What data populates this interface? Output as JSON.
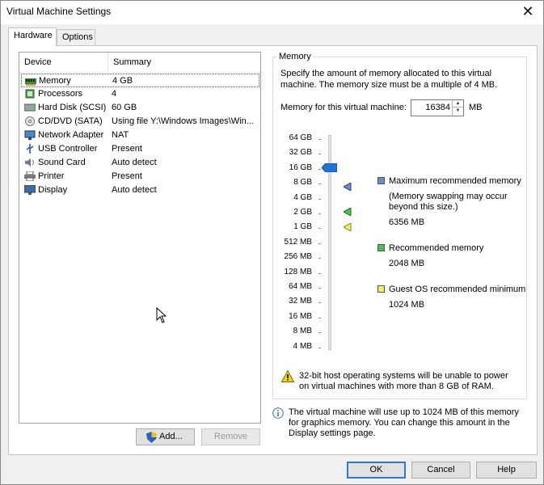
{
  "window": {
    "title": "Virtual Machine Settings",
    "close_glyph": "✕"
  },
  "tabs": [
    {
      "label": "Hardware",
      "active": true
    },
    {
      "label": "Options",
      "active": false
    }
  ],
  "device_table": {
    "headers": {
      "device": "Device",
      "summary": "Summary"
    },
    "rows": [
      {
        "name": "Memory",
        "summary": "4 GB",
        "icon": "memory-icon",
        "selected": true
      },
      {
        "name": "Processors",
        "summary": "4",
        "icon": "processor-icon"
      },
      {
        "name": "Hard Disk (SCSI)",
        "summary": "60 GB",
        "icon": "hard-disk-icon"
      },
      {
        "name": "CD/DVD (SATA)",
        "summary": "Using file Y:\\Windows Images\\Win...",
        "icon": "cd-dvd-icon"
      },
      {
        "name": "Network Adapter",
        "summary": "NAT",
        "icon": "network-adapter-icon"
      },
      {
        "name": "USB Controller",
        "summary": "Present",
        "icon": "usb-controller-icon"
      },
      {
        "name": "Sound Card",
        "summary": "Auto detect",
        "icon": "sound-card-icon"
      },
      {
        "name": "Printer",
        "summary": "Present",
        "icon": "printer-icon"
      },
      {
        "name": "Display",
        "summary": "Auto detect",
        "icon": "display-icon"
      }
    ]
  },
  "buttons": {
    "add": "Add...",
    "remove": "Remove",
    "ok": "OK",
    "cancel": "Cancel",
    "help": "Help"
  },
  "memory": {
    "group_label": "Memory",
    "description": "Specify the amount of memory allocated to this virtual machine. The memory size must be a multiple of 4 MB.",
    "field_label": "Memory for this virtual machine:",
    "value": "16384",
    "unit": "MB",
    "scale_labels": [
      "64 GB",
      "32 GB",
      "16 GB",
      "8 GB",
      "4 GB",
      "2 GB",
      "1 GB",
      "512 MB",
      "256 MB",
      "128 MB",
      "64 MB",
      "32 MB",
      "16 MB",
      "8 MB",
      "4 MB"
    ],
    "slider_value": "16 GB",
    "legend": {
      "max": {
        "title": "Maximum recommended memory",
        "note": "(Memory swapping may occur beyond this size.)",
        "value": "6356 MB",
        "color": "#6a8fc7"
      },
      "recommended": {
        "title": "Recommended memory",
        "value": "2048 MB",
        "color": "#4cc04c"
      },
      "guest_min": {
        "title": "Guest OS recommended minimum",
        "value": "1024 MB",
        "color": "#f2ec6a"
      }
    },
    "warning": "32-bit host operating systems will be unable to power on virtual machines with more than 8 GB of RAM.",
    "info": "The virtual machine will use up to 1024 MB of this memory for graphics memory. You can change this amount in the Display settings page."
  }
}
